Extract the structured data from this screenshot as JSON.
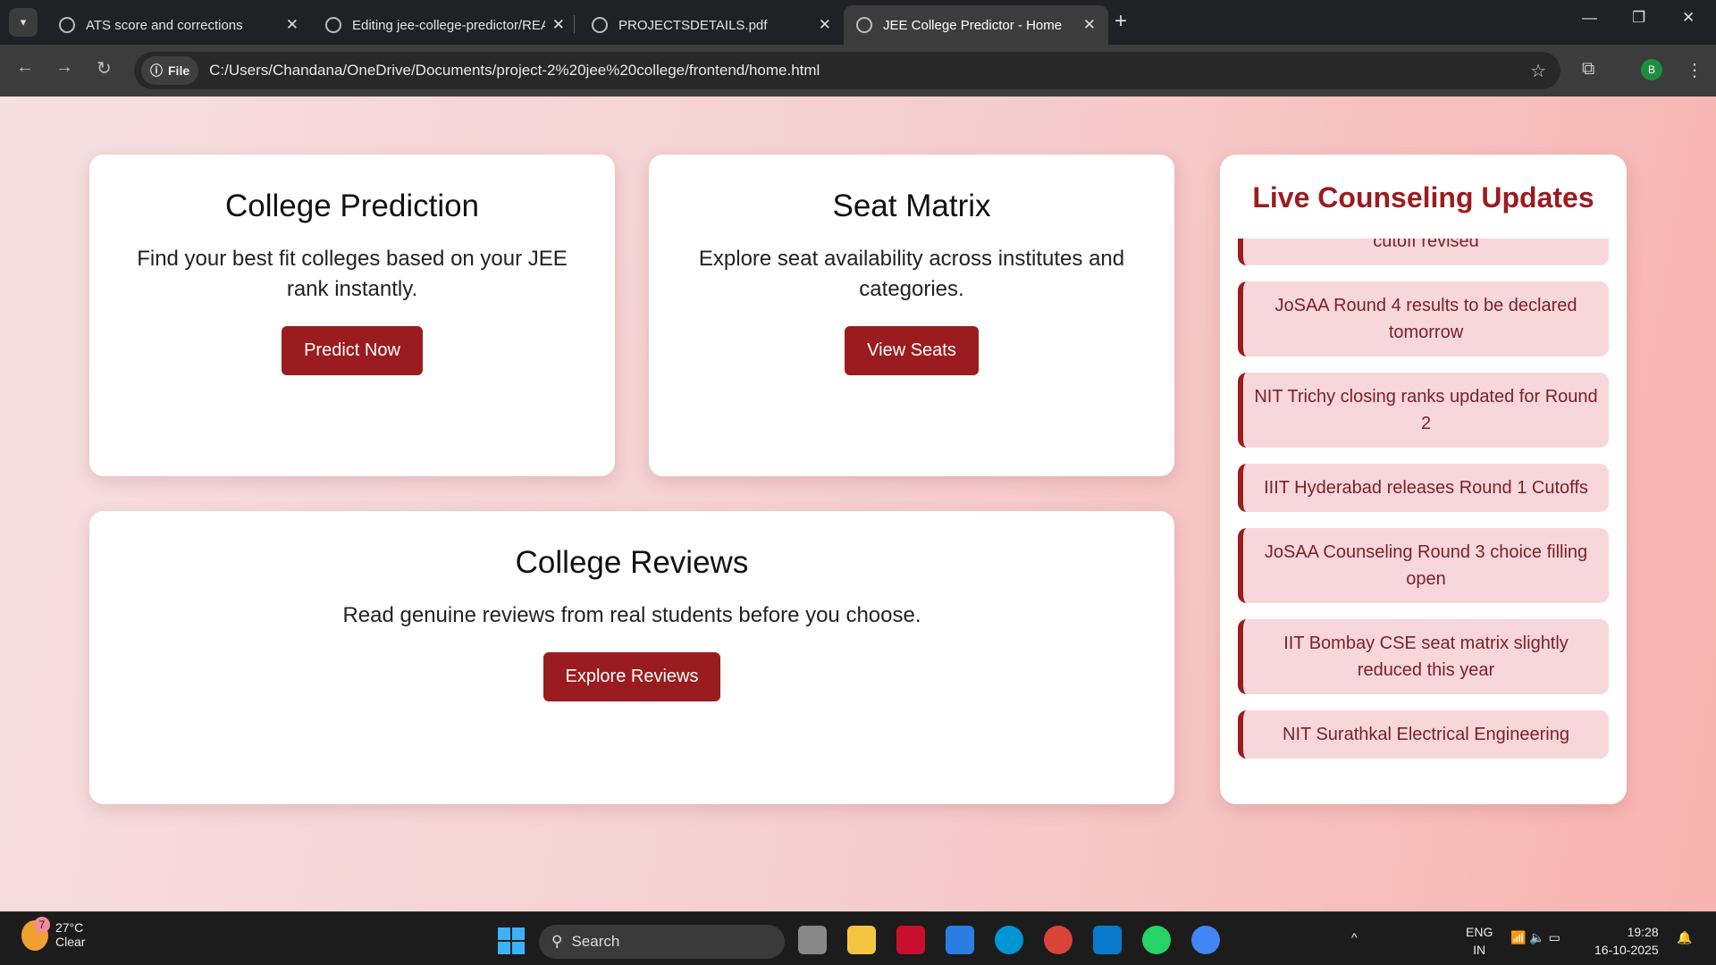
{
  "browser": {
    "tabs": [
      {
        "title": "ATS score and corrections",
        "active": false
      },
      {
        "title": "Editing jee-college-predictor/README",
        "active": false
      },
      {
        "title": "PROJECTSDETAILS.pdf",
        "active": false
      },
      {
        "title": "JEE College Predictor - Home",
        "active": true
      }
    ],
    "close_glyph": "✕",
    "new_tab": "+",
    "scheme_chip": "File",
    "url": "C:/Users/Chandana/OneDrive/Documents/project-2%20jee%20college/frontend/home.html",
    "profile_initial": "B"
  },
  "cards": {
    "prediction": {
      "title": "College Prediction",
      "text": "Find your best fit colleges based on your JEE rank instantly.",
      "button": "Predict Now"
    },
    "seats": {
      "title": "Seat Matrix",
      "text": "Explore seat availability across institutes and categories.",
      "button": "View Seats"
    },
    "reviews": {
      "title": "College Reviews",
      "text": "Read genuine reviews from real students before you choose.",
      "button": "Explore Reviews"
    }
  },
  "live": {
    "title": "Live Counseling Updates",
    "items": [
      "cutoff revised",
      "JoSAA Round 4 results to be declared tomorrow",
      "NIT Trichy closing ranks updated for Round 2",
      "IIIT Hyderabad releases Round 1 Cutoffs",
      "JoSAA Counseling Round 3 choice filling open",
      "IIT Bombay CSE seat matrix slightly reduced this year",
      "NIT Surathkal Electrical Engineering"
    ]
  },
  "colors": {
    "accent": "#9b1c1f",
    "news_bg": "#f8d7da"
  },
  "taskbar": {
    "weather_temp": "27°C",
    "weather_text": "Clear",
    "weather_badge": "7",
    "search": "Search",
    "lang": "ENG",
    "region": "IN",
    "time": "19:28",
    "date": "16-10-2025"
  }
}
